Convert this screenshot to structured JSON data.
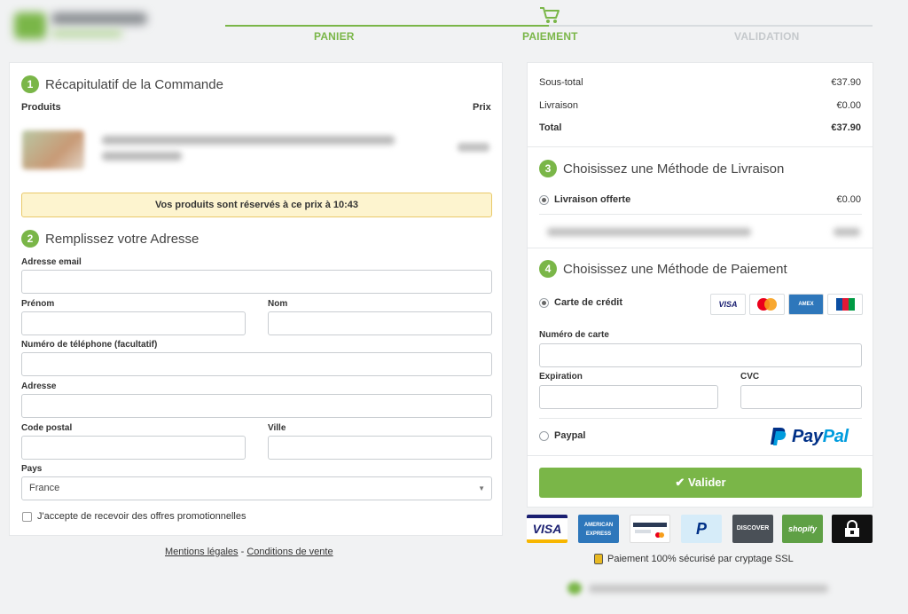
{
  "steps": [
    "PANIER",
    "PAIEMENT",
    "VALIDATION"
  ],
  "colors": {
    "accent": "#7ab648",
    "notice_bg": "#fdf4cf",
    "inactive_step": "#c5c9cc"
  },
  "summary": {
    "number": "1",
    "title": "Récapitulatif de la Commande",
    "col_products": "Produits",
    "col_price": "Prix",
    "reserve_notice": "Vos produits sont réservés à ce prix à 10:43"
  },
  "address": {
    "number": "2",
    "title": "Remplissez votre Adresse",
    "email_label": "Adresse email",
    "firstname_label": "Prénom",
    "lastname_label": "Nom",
    "phone_label": "Numéro de téléphone (facultatif)",
    "address_label": "Adresse",
    "postal_label": "Code postal",
    "city_label": "Ville",
    "country_label": "Pays",
    "country_value": "France",
    "promo_label": "J'accepte de recevoir des offres promotionnelles"
  },
  "totals": {
    "subtotal_label": "Sous-total",
    "subtotal_value": "€37.90",
    "shipping_label": "Livraison",
    "shipping_value": "€0.00",
    "total_label": "Total",
    "total_value": "€37.90"
  },
  "delivery": {
    "number": "3",
    "title": "Choisissez une Méthode de Livraison",
    "option_label": "Livraison offerte",
    "option_value": "€0.00"
  },
  "payment": {
    "number": "4",
    "title": "Choisissez une Méthode de Paiement",
    "card_label": "Carte de crédit",
    "card_number_label": "Numéro de carte",
    "expiry_label": "Expiration",
    "cvc_label": "CVC",
    "paypal_label": "Paypal",
    "paypal_logo_text_1": "Pay",
    "paypal_logo_text_2": "Pal",
    "card_logos": [
      "VISA",
      "MC",
      "AMEX",
      "JCB"
    ],
    "submit_label": "Valider",
    "checkmark": "✔"
  },
  "badges": [
    "VISA",
    "AMERICAN EXPRESS",
    "CARD",
    "P",
    "DISCOVER",
    "shopify",
    "SSL"
  ],
  "ssl_text": "Paiement 100% sécurisé par cryptage SSL",
  "footer": {
    "legal": "Mentions légales",
    "separator": "-",
    "terms": "Conditions de vente"
  }
}
